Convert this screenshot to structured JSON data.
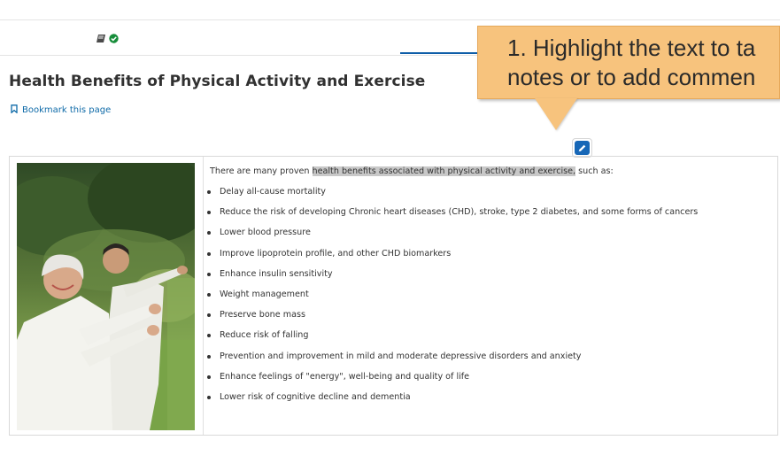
{
  "unit": {
    "title": "Health Benefits of Physical Activity and Exercise",
    "bookmark_label": "Bookmark this page"
  },
  "sequence_nav": {
    "active_tab_icons": [
      "book-icon",
      "check-circle-icon"
    ],
    "active_tab_status": "completed"
  },
  "content": {
    "intro_before": "There are many proven ",
    "intro_highlight": "health benefits associated with physical activity and exercise,",
    "intro_after": " such as:",
    "benefits": [
      "Delay all-cause mortality",
      "Reduce the risk of developing Chronic heart diseases (CHD), stroke, type 2 diabetes, and some forms of cancers",
      "Lower blood pressure",
      "Improve lipoprotein profile, and other CHD biomarkers",
      "Enhance insulin sensitivity",
      "Weight management",
      "Preserve bone mass",
      "Reduce risk of falling",
      "Prevention and improvement in mild and moderate depressive disorders and anxiety",
      "Enhance feelings of \"energy\", well-being and quality of life",
      "Lower risk of cognitive decline and dementia"
    ]
  },
  "callout": {
    "line1": "1. Highlight the text to ta",
    "line2": "notes or to add commen"
  },
  "colors": {
    "accent_blue": "#0e5da8",
    "link_blue": "#0e6aa8",
    "success_green": "#178d3a",
    "callout_fill": "#f7c37d",
    "highlight_grey": "#c8c8c8"
  }
}
